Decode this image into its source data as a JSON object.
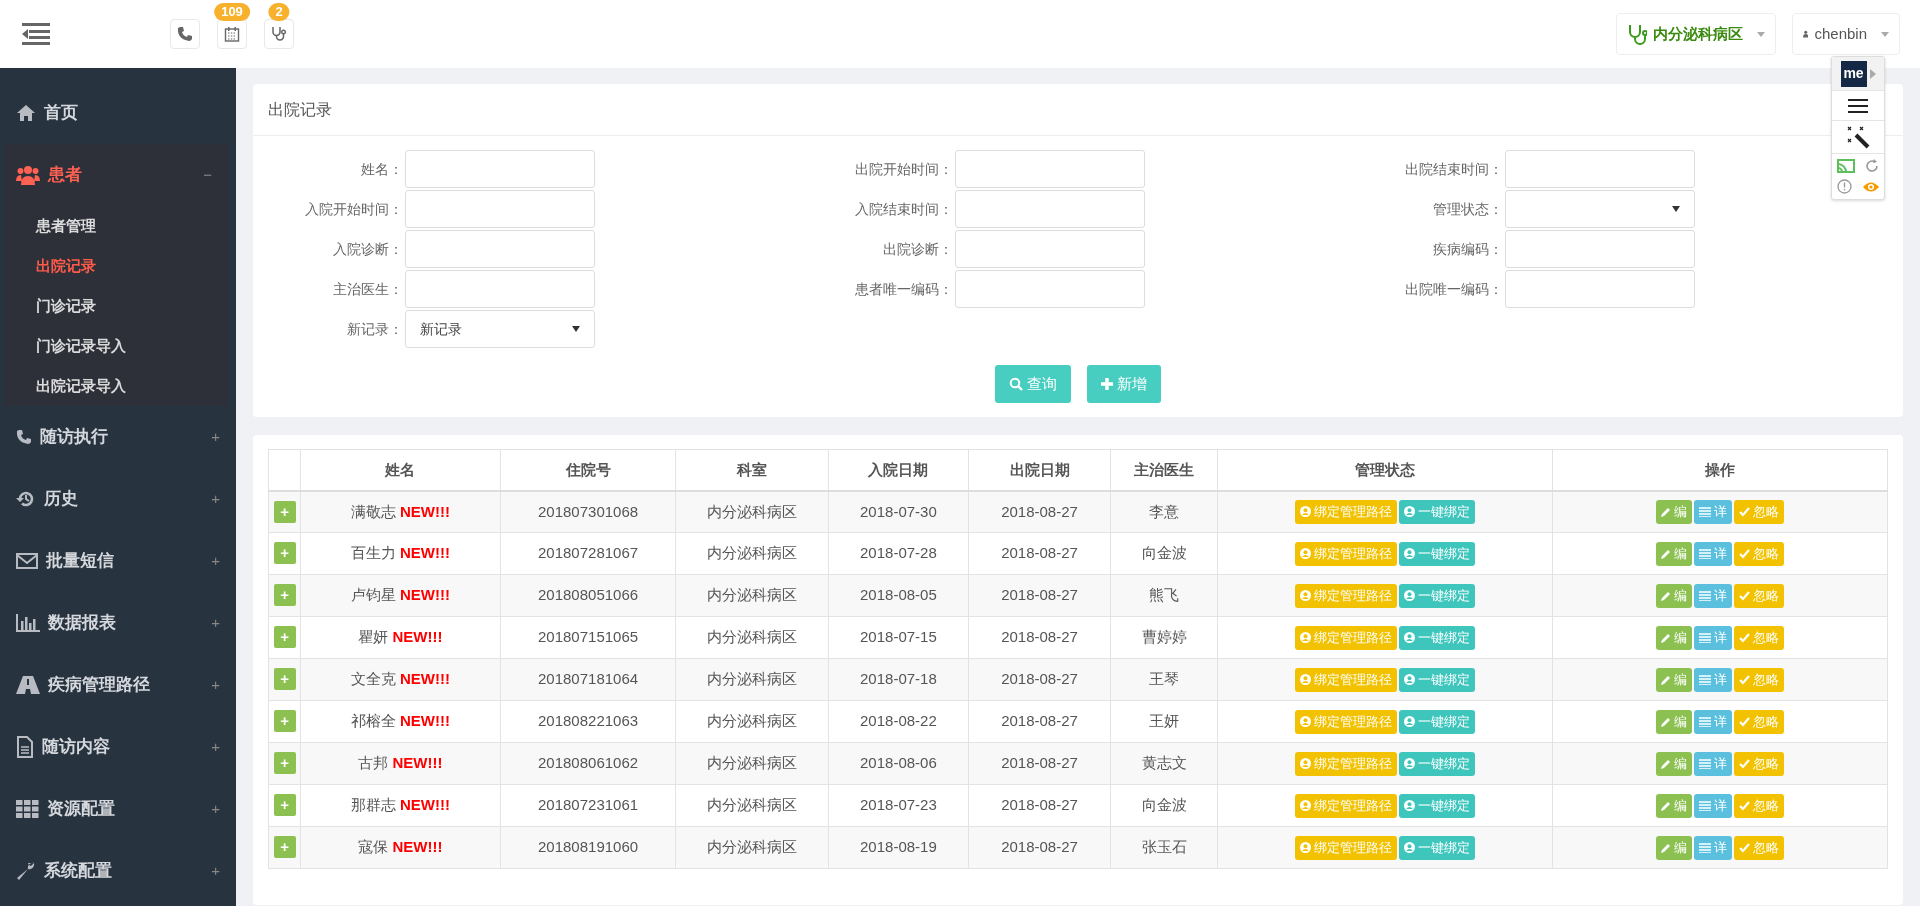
{
  "topbar": {
    "badges": [
      {
        "kind": "phone"
      },
      {
        "kind": "calendar",
        "count": "109"
      },
      {
        "kind": "stethoscope",
        "count": "2"
      }
    ],
    "department": "内分泌科病区",
    "user": "chenbin"
  },
  "ext_toolbar": {
    "logo": "me"
  },
  "sidebar": {
    "items": [
      {
        "label": "首页",
        "expanded": false
      },
      {
        "label": "患者",
        "expanded": true,
        "toggle": "−",
        "children": [
          {
            "label": "患者管理",
            "selected": false
          },
          {
            "label": "出院记录",
            "selected": true
          },
          {
            "label": "门诊记录",
            "selected": false
          },
          {
            "label": "门诊记录导入",
            "selected": false
          },
          {
            "label": "出院记录导入",
            "selected": false
          }
        ]
      },
      {
        "label": "随访执行",
        "expanded": false,
        "toggle": "+"
      },
      {
        "label": "历史",
        "expanded": false,
        "toggle": "+"
      },
      {
        "label": "批量短信",
        "expanded": false,
        "toggle": "+"
      },
      {
        "label": "数据报表",
        "expanded": false,
        "toggle": "+"
      },
      {
        "label": "疾病管理路径",
        "expanded": false,
        "toggle": "+"
      },
      {
        "label": "随访内容",
        "expanded": false,
        "toggle": "+"
      },
      {
        "label": "资源配置",
        "expanded": false,
        "toggle": "+"
      },
      {
        "label": "系统配置",
        "expanded": false,
        "toggle": "+"
      }
    ]
  },
  "search_panel": {
    "title": "出院记录",
    "filters": [
      [
        {
          "label": "姓名：",
          "kind": "input"
        },
        {
          "label": "出院开始时间：",
          "kind": "input"
        },
        {
          "label": "出院结束时间：",
          "kind": "input"
        }
      ],
      [
        {
          "label": "入院开始时间：",
          "kind": "input"
        },
        {
          "label": "入院结束时间：",
          "kind": "input"
        },
        {
          "label": "管理状态：",
          "kind": "select"
        }
      ],
      [
        {
          "label": "入院诊断：",
          "kind": "input"
        },
        {
          "label": "出院诊断：",
          "kind": "input"
        },
        {
          "label": "疾病编码：",
          "kind": "input"
        }
      ],
      [
        {
          "label": "主治医生：",
          "kind": "input"
        },
        {
          "label": "患者唯一编码：",
          "kind": "input"
        },
        {
          "label": "出院唯一编码：",
          "kind": "input"
        }
      ],
      [
        {
          "label": "新记录：",
          "kind": "select",
          "value": "新记录"
        }
      ]
    ],
    "buttons": [
      {
        "label": "查询"
      },
      {
        "label": "新增"
      }
    ]
  },
  "table": {
    "columns": [
      "姓名",
      "住院号",
      "科室",
      "入院日期",
      "出院日期",
      "主治医生",
      "管理状态",
      "操作"
    ],
    "rows": [
      {
        "expand": "+",
        "name": "满敬志",
        "flag": "NEW!!!",
        "admission_no": "201807301068",
        "dept": "内分泌科病区",
        "admit": "2018-07-30",
        "discharge": "2018-08-27",
        "doctor": "李意",
        "status_buttons": [
          "绑定管理路径",
          "一键绑定"
        ],
        "action_buttons": [
          "编",
          "详",
          "忽略"
        ]
      },
      {
        "expand": "+",
        "name": "百生力",
        "flag": "NEW!!!",
        "admission_no": "201807281067",
        "dept": "内分泌科病区",
        "admit": "2018-07-28",
        "discharge": "2018-08-27",
        "doctor": "向金波",
        "status_buttons": [
          "绑定管理路径",
          "一键绑定"
        ],
        "action_buttons": [
          "编",
          "详",
          "忽略"
        ]
      },
      {
        "expand": "+",
        "name": "卢钧星",
        "flag": "NEW!!!",
        "admission_no": "201808051066",
        "dept": "内分泌科病区",
        "admit": "2018-08-05",
        "discharge": "2018-08-27",
        "doctor": "熊飞",
        "status_buttons": [
          "绑定管理路径",
          "一键绑定"
        ],
        "action_buttons": [
          "编",
          "详",
          "忽略"
        ]
      },
      {
        "expand": "+",
        "name": "瞿妍",
        "flag": "NEW!!!",
        "admission_no": "201807151065",
        "dept": "内分泌科病区",
        "admit": "2018-07-15",
        "discharge": "2018-08-27",
        "doctor": "曹婷婷",
        "status_buttons": [
          "绑定管理路径",
          "一键绑定"
        ],
        "action_buttons": [
          "编",
          "详",
          "忽略"
        ]
      },
      {
        "expand": "+",
        "name": "文全克",
        "flag": "NEW!!!",
        "admission_no": "201807181064",
        "dept": "内分泌科病区",
        "admit": "2018-07-18",
        "discharge": "2018-08-27",
        "doctor": "王琴",
        "status_buttons": [
          "绑定管理路径",
          "一键绑定"
        ],
        "action_buttons": [
          "编",
          "详",
          "忽略"
        ]
      },
      {
        "expand": "+",
        "name": "祁榕全",
        "flag": "NEW!!!",
        "admission_no": "201808221063",
        "dept": "内分泌科病区",
        "admit": "2018-08-22",
        "discharge": "2018-08-27",
        "doctor": "王妍",
        "status_buttons": [
          "绑定管理路径",
          "一键绑定"
        ],
        "action_buttons": [
          "编",
          "详",
          "忽略"
        ]
      },
      {
        "expand": "+",
        "name": "古邦",
        "flag": "NEW!!!",
        "admission_no": "201808061062",
        "dept": "内分泌科病区",
        "admit": "2018-08-06",
        "discharge": "2018-08-27",
        "doctor": "黄志文",
        "status_buttons": [
          "绑定管理路径",
          "一键绑定"
        ],
        "action_buttons": [
          "编",
          "详",
          "忽略"
        ]
      },
      {
        "expand": "+",
        "name": "那群志",
        "flag": "NEW!!!",
        "admission_no": "201807231061",
        "dept": "内分泌科病区",
        "admit": "2018-07-23",
        "discharge": "2018-08-27",
        "doctor": "向金波",
        "status_buttons": [
          "绑定管理路径",
          "一键绑定"
        ],
        "action_buttons": [
          "编",
          "详",
          "忽略"
        ]
      },
      {
        "expand": "+",
        "name": "寇保",
        "flag": "NEW!!!",
        "admission_no": "201808191060",
        "dept": "内分泌科病区",
        "admit": "2018-08-19",
        "discharge": "2018-08-27",
        "doctor": "张玉石",
        "status_buttons": [
          "绑定管理路径",
          "一键绑定"
        ],
        "action_buttons": [
          "编",
          "详",
          "忽略"
        ]
      }
    ]
  }
}
